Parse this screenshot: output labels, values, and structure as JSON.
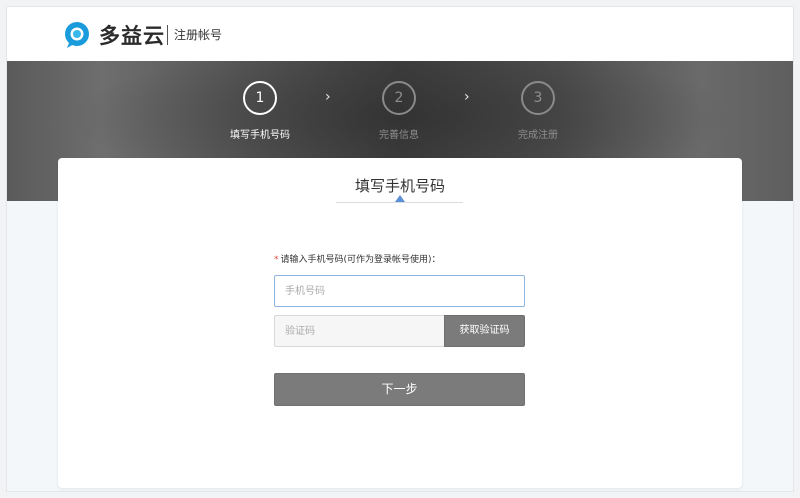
{
  "header": {
    "logo_text": "多益云",
    "subtitle": "注册帐号",
    "logo_color": "#1a9bdb"
  },
  "steps": [
    {
      "number": "1",
      "label": "填写手机号码",
      "state": "active"
    },
    {
      "number": "2",
      "label": "完善信息",
      "state": "inactive"
    },
    {
      "number": "3",
      "label": "完成注册",
      "state": "inactive"
    }
  ],
  "step_separator_glyph": "›",
  "card": {
    "title": "填写手机号码",
    "accent_color": "#5b8fd6"
  },
  "form": {
    "required_mark": "*",
    "phone_label": "请输入手机号码(可作为登录帐号使用)：",
    "phone_placeholder": "手机号码",
    "phone_value": "",
    "code_placeholder": "验证码",
    "code_value": "",
    "get_code_label": "获取验证码",
    "next_label": "下一步"
  }
}
